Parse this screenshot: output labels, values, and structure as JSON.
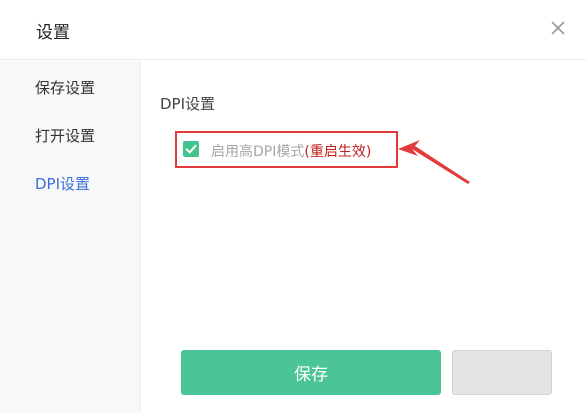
{
  "window": {
    "title": "设置"
  },
  "sidebar": {
    "items": [
      {
        "label": "保存设置"
      },
      {
        "label": "打开设置"
      },
      {
        "label": "DPI设置"
      }
    ]
  },
  "section": {
    "title": "DPI设置"
  },
  "option": {
    "checked": true,
    "label": "启用高DPI模式",
    "note": "(重启生效)"
  },
  "actions": {
    "save_label": "保存"
  },
  "colors": {
    "accent": "#4bc596",
    "active_nav": "#3f6fd8",
    "highlight": "#e33b3b"
  },
  "icons": {
    "close": "close-icon",
    "check": "check-icon",
    "arrow": "arrow-icon"
  }
}
